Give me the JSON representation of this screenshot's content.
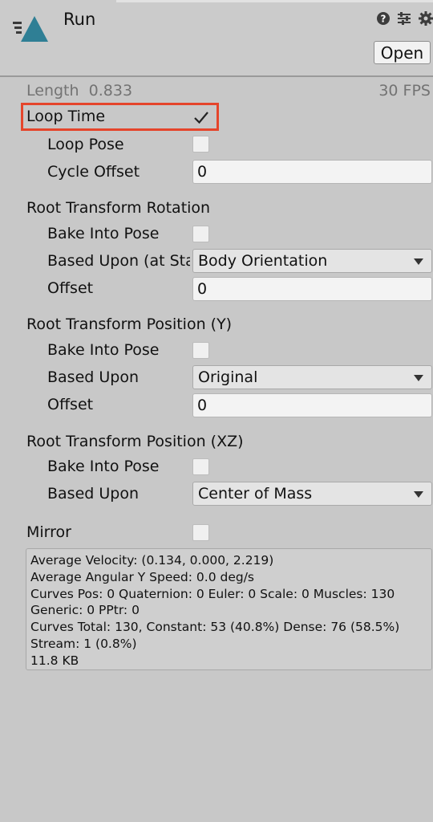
{
  "header": {
    "title": "Run",
    "open_button": "Open",
    "icons": [
      "help-icon",
      "preset-sliders-icon",
      "gear-icon"
    ]
  },
  "clip_info": {
    "length_label": "Length",
    "length_value": "0.833",
    "fps": "30 FPS"
  },
  "loop_time": {
    "label": "Loop Time",
    "checked": true
  },
  "loop_pose": {
    "label": "Loop Pose",
    "checked": false
  },
  "cycle_offset": {
    "label": "Cycle Offset",
    "value": "0"
  },
  "root_rotation": {
    "heading": "Root Transform Rotation",
    "bake_label": "Bake Into Pose",
    "based_upon_label": "Based Upon (at Start)",
    "based_upon_value": "Body Orientation",
    "offset_label": "Offset",
    "offset_value": "0"
  },
  "root_position_y": {
    "heading": "Root Transform Position (Y)",
    "bake_label": "Bake Into Pose",
    "based_upon_label": "Based Upon",
    "based_upon_value": "Original",
    "offset_label": "Offset",
    "offset_value": "0"
  },
  "root_position_xz": {
    "heading": "Root Transform Position (XZ)",
    "bake_label": "Bake Into Pose",
    "based_upon_label": "Based Upon",
    "based_upon_value": "Center of Mass"
  },
  "mirror": {
    "label": "Mirror",
    "checked": false
  },
  "info": {
    "lines": [
      "Average Velocity: (0.134, 0.000, 2.219)",
      "Average Angular Y Speed: 0.0 deg/s",
      "Curves Pos: 0 Quaternion: 0 Euler: 0 Scale: 0 Muscles: 130",
      "Generic: 0 PPtr: 0",
      "Curves Total: 130, Constant: 53 (40.8%) Dense: 76 (58.5%)",
      "Stream: 1 (0.8%)",
      "11.8 KB"
    ]
  },
  "colors": {
    "highlight": "#e5452b",
    "icon_blue": "#2f7f95",
    "background": "#c8c8c8"
  }
}
